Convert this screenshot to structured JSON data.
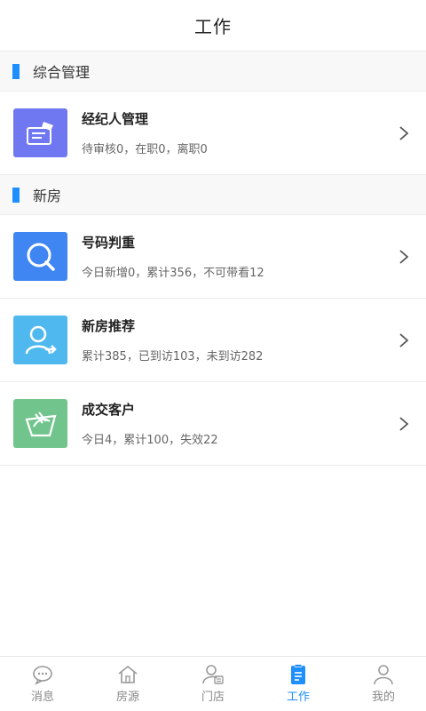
{
  "header": {
    "title": "工作"
  },
  "sections": [
    {
      "title": "综合管理",
      "items": [
        {
          "title": "经纪人管理",
          "subtitle": "待审核0，在职0，离职0",
          "icon": "agent-card-icon",
          "color": "#6f78f0"
        }
      ]
    },
    {
      "title": "新房",
      "items": [
        {
          "title": "号码判重",
          "subtitle": "今日新增0，累计356，不可带看12",
          "icon": "search-icon",
          "color": "#3f86f3"
        },
        {
          "title": "新房推荐",
          "subtitle": "累计385，已到访103，未到访282",
          "icon": "user-arrow-icon",
          "color": "#4fb8ee"
        },
        {
          "title": "成交客户",
          "subtitle": "今日4，累计100，失效22",
          "icon": "handshake-icon",
          "color": "#71c58c"
        }
      ]
    }
  ],
  "bottom_nav": [
    {
      "label": "消息",
      "icon": "message-icon",
      "active": false
    },
    {
      "label": "房源",
      "icon": "house-icon",
      "active": false
    },
    {
      "label": "门店",
      "icon": "store-icon",
      "active": false
    },
    {
      "label": "工作",
      "icon": "work-icon",
      "active": true
    },
    {
      "label": "我的",
      "icon": "profile-icon",
      "active": false
    }
  ],
  "colors": {
    "accent": "#1e8fff",
    "nav_inactive": "#888888"
  }
}
